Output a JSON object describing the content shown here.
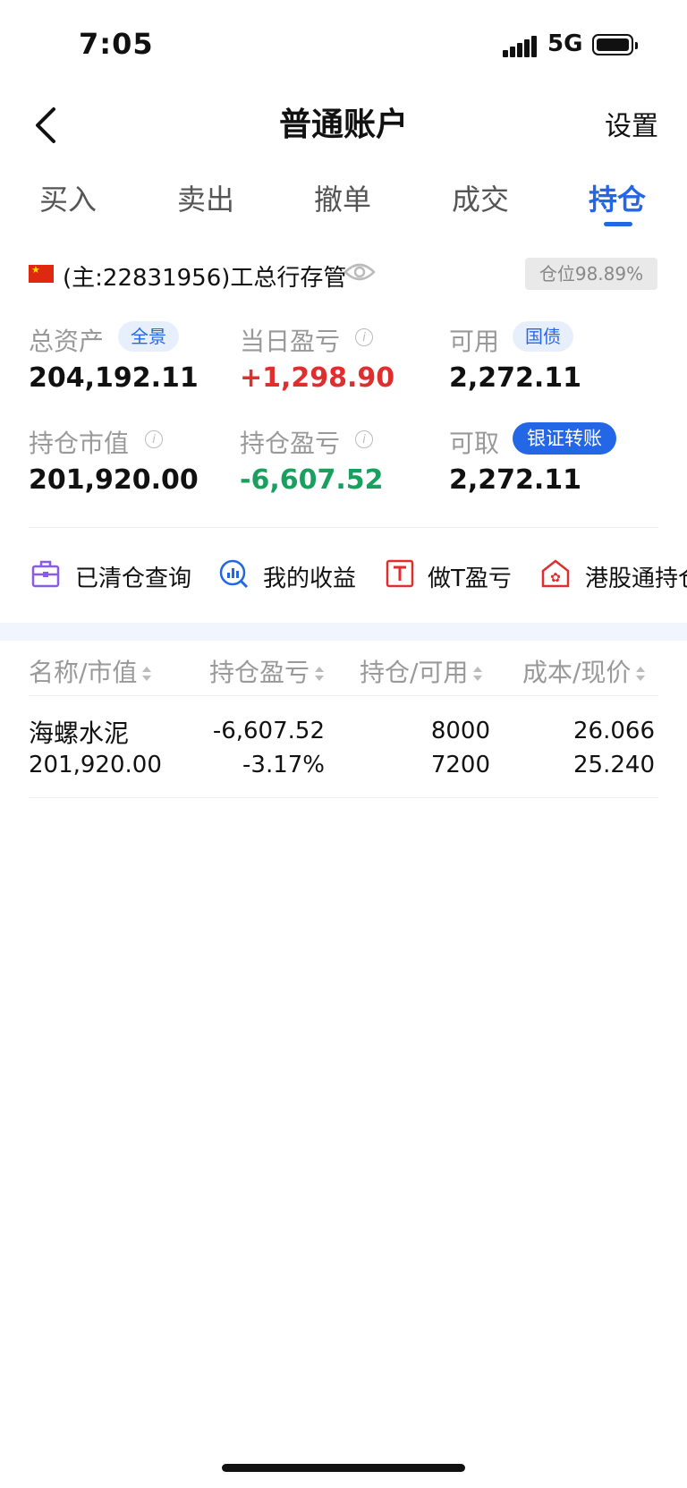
{
  "status_bar": {
    "time": "7:05",
    "network": "5G"
  },
  "nav": {
    "title": "普通账户",
    "settings_label": "设置"
  },
  "tabs": [
    {
      "label": "买入"
    },
    {
      "label": "卖出"
    },
    {
      "label": "撤单"
    },
    {
      "label": "成交"
    },
    {
      "label": "持仓",
      "active": true
    }
  ],
  "account": {
    "name": "(主:22831956)工总行存管",
    "position_badge": "仓位98.89%"
  },
  "metrics": {
    "total_assets": {
      "label": "总资产",
      "pill": "全景",
      "value": "204,192.11"
    },
    "daily_pnl": {
      "label": "当日盈亏",
      "value": "+1,298.90"
    },
    "available": {
      "label": "可用",
      "pill": "国债",
      "value": "2,272.11"
    },
    "holding_value": {
      "label": "持仓市值",
      "value": "201,920.00"
    },
    "holding_pnl": {
      "label": "持仓盈亏",
      "value": "-6,607.52"
    },
    "withdrawable": {
      "label": "可取",
      "pill": "银证转账",
      "value": "2,272.11"
    }
  },
  "quick_links": [
    {
      "label": "已清仓查询",
      "icon": "briefcase-icon"
    },
    {
      "label": "我的收益",
      "icon": "chart-search-icon"
    },
    {
      "label": "做T盈亏",
      "icon": "t-box-icon"
    },
    {
      "label": "港股通持仓",
      "icon": "hk-bauhinia-icon"
    }
  ],
  "table": {
    "headers": [
      "名称/市值",
      "持仓盈亏",
      "持仓/可用",
      "成本/现价"
    ],
    "rows": [
      {
        "name": "海螺水泥",
        "market_value": "201,920.00",
        "pnl": "-6,607.52",
        "pnl_pct": "-3.17%",
        "holding": "8000",
        "available": "7200",
        "cost": "26.066",
        "price": "25.240"
      }
    ]
  },
  "colors": {
    "accent": "#2467e6",
    "up": "#e02e2e",
    "down": "#1aa05e"
  }
}
